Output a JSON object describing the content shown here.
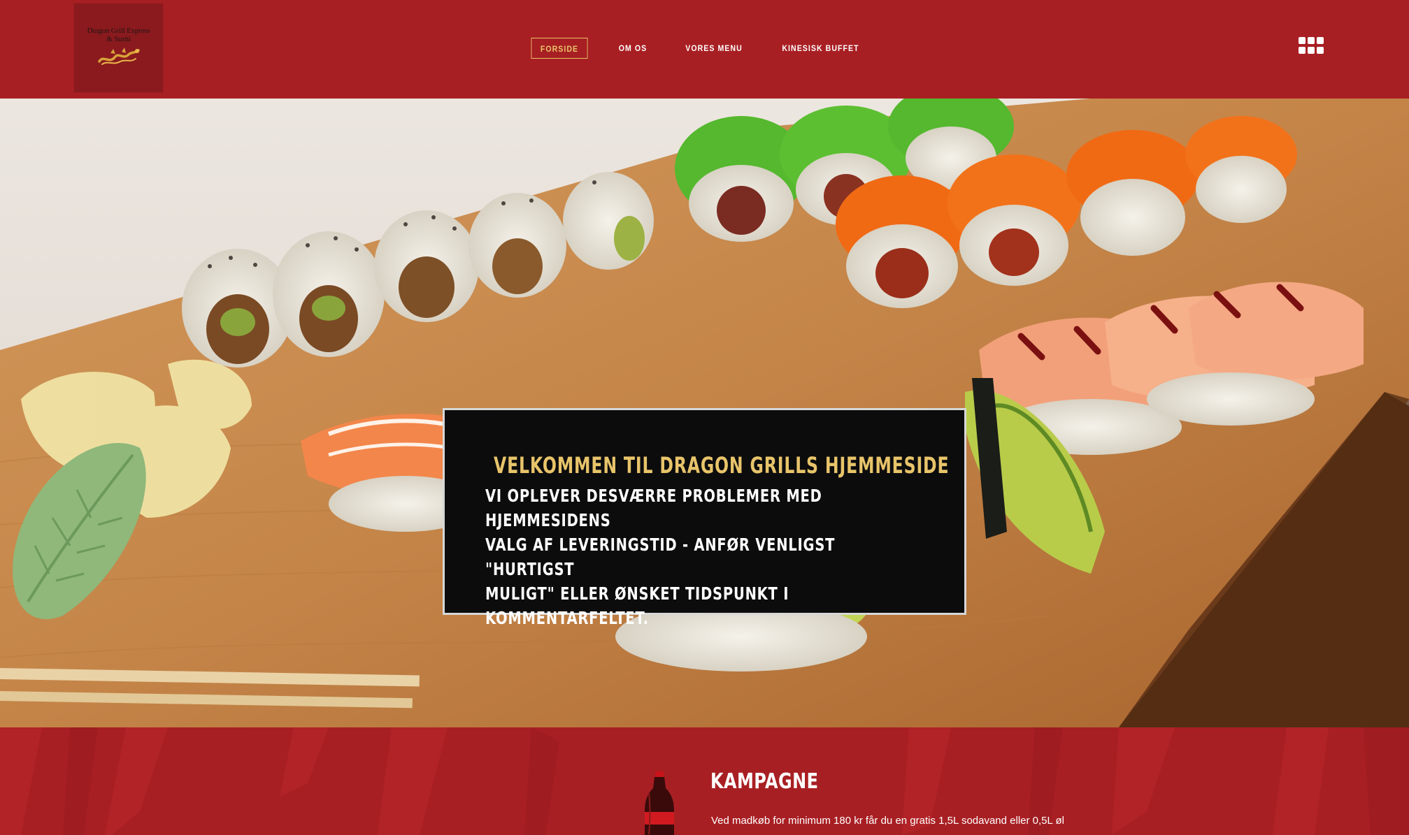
{
  "logo": {
    "line1": "Dragon Grill Express",
    "line2": "& Sushi",
    "icon": "dragon-icon"
  },
  "nav": {
    "items": [
      {
        "label": "FORSIDE",
        "active": true
      },
      {
        "label": "OM OS",
        "active": false
      },
      {
        "label": "VORES MENU",
        "active": false
      },
      {
        "label": "KINESISK BUFFET",
        "active": false
      }
    ],
    "apps_icon": "grid-menu-icon"
  },
  "hero": {
    "title": "VELKOMMEN TIL DRAGON GRILLS HJEMMESIDE",
    "message_lines": [
      "VI OPLEVER DESVÆRRE PROBLEMER MED HJEMMESIDENS",
      "VALG AF LEVERINGSTID - ANFØR VENLIGST \"HURTIGST",
      "MULIGT\" ELLER ØNSKET TIDSPUNKT I KOMMENTARFELTET."
    ]
  },
  "campaign": {
    "title": "KAMPAGNE",
    "text": "Ved madkøb for minimum 180 kr får du en gratis 1,5L sodavand eller 0,5L øl",
    "image_icon": "soda-bottle-icon"
  },
  "colors": {
    "brand_red": "#a81f23",
    "accent_gold": "#e8c46a",
    "box_black": "#0c0c0d"
  }
}
